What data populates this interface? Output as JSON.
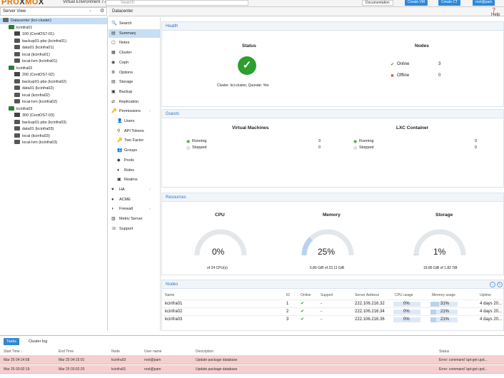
{
  "app": {
    "logo_a": "PRO",
    "logo_x": "X",
    "logo_b": "MO",
    "logo_x2": "X",
    "version": "Virtual Environment 7.4-3",
    "search_placeholder": "Search",
    "buttons": {
      "documentation": "Documentation",
      "create_vm": "Create VM",
      "create_ct": "Create CT",
      "user": "root@pam"
    }
  },
  "server_view": {
    "label": "Server View"
  },
  "tree": [
    {
      "label": "Datacenter (kci-cluster)",
      "icon": "datacenter-icon",
      "level": 0
    },
    {
      "label": "kcinfra01",
      "icon": "node-icon",
      "level": 1
    },
    {
      "label": "100 (CentOS7-01)",
      "icon": "vm-icon",
      "level": 2
    },
    {
      "label": "backup01-pbs (kcinfra01)",
      "icon": "storage-icon",
      "level": 2
    },
    {
      "label": "data01 (kcinfra01)",
      "icon": "storage-icon",
      "level": 2
    },
    {
      "label": "local (kcinfra01)",
      "icon": "storage-icon",
      "level": 2
    },
    {
      "label": "local-lvm (kcinfra01)",
      "icon": "storage-icon",
      "level": 2
    },
    {
      "label": "kcinfra02",
      "icon": "node-icon",
      "level": 1
    },
    {
      "label": "200 (CentOS7-02)",
      "icon": "vm-icon",
      "level": 2
    },
    {
      "label": "backup01-pbs (kcinfra02)",
      "icon": "storage-icon",
      "level": 2
    },
    {
      "label": "data01 (kcinfra02)",
      "icon": "storage-icon",
      "level": 2
    },
    {
      "label": "local (kcinfra02)",
      "icon": "storage-icon",
      "level": 2
    },
    {
      "label": "local-lvm (kcinfra02)",
      "icon": "storage-icon",
      "level": 2
    },
    {
      "label": "kcinfra03",
      "icon": "node-icon",
      "level": 1
    },
    {
      "label": "300 (CentOS7-03)",
      "icon": "vm-icon",
      "level": 2
    },
    {
      "label": "backup01-pbs (kcinfra03)",
      "icon": "storage-icon",
      "level": 2
    },
    {
      "label": "data01 (kcinfra03)",
      "icon": "storage-icon",
      "level": 2
    },
    {
      "label": "local (kcinfra03)",
      "icon": "storage-icon",
      "level": 2
    },
    {
      "label": "local-lvm (kcinfra03)",
      "icon": "storage-icon",
      "level": 2
    }
  ],
  "crumb": "Datacenter",
  "help": "Help",
  "menu": [
    {
      "label": "Search",
      "icon": "search-icon",
      "glyph": "🔍"
    },
    {
      "label": "Summary",
      "icon": "summary-icon",
      "glyph": "▤",
      "selected": true
    },
    {
      "label": "Notes",
      "icon": "notes-icon",
      "glyph": "▢"
    },
    {
      "label": "Cluster",
      "icon": "cluster-icon",
      "glyph": "▦"
    },
    {
      "label": "Ceph",
      "icon": "ceph-icon",
      "glyph": "◉"
    },
    {
      "label": "Options",
      "icon": "options-icon",
      "glyph": "⚙"
    },
    {
      "label": "Storage",
      "icon": "storage-icon",
      "glyph": "▤"
    },
    {
      "label": "Backup",
      "icon": "backup-icon",
      "glyph": "▣"
    },
    {
      "label": "Replication",
      "icon": "replication-icon",
      "glyph": "⇄"
    },
    {
      "label": "Permissions",
      "icon": "permissions-icon",
      "glyph": "🔑",
      "expand": true
    },
    {
      "label": "Users",
      "icon": "user-icon",
      "glyph": "👤",
      "sub": true
    },
    {
      "label": "API Tokens",
      "icon": "api-token-icon",
      "glyph": "⚲",
      "sub": true
    },
    {
      "label": "Two Factor",
      "icon": "two-factor-icon",
      "glyph": "🔑",
      "sub": true
    },
    {
      "label": "Groups",
      "icon": "groups-icon",
      "glyph": "👥",
      "sub": true
    },
    {
      "label": "Pools",
      "icon": "pools-icon",
      "glyph": "◆",
      "sub": true
    },
    {
      "label": "Roles",
      "icon": "roles-icon",
      "glyph": "♦",
      "sub": true
    },
    {
      "label": "Realms",
      "icon": "realms-icon",
      "glyph": "▣",
      "sub": true
    },
    {
      "label": "HA",
      "icon": "ha-icon",
      "glyph": "♥",
      "expand": true
    },
    {
      "label": "ACME",
      "icon": "acme-icon",
      "glyph": "●"
    },
    {
      "label": "Firewall",
      "icon": "firewall-icon",
      "glyph": "◗",
      "expand": true
    },
    {
      "label": "Metric Server",
      "icon": "metric-icon",
      "glyph": "▥"
    },
    {
      "label": "Support",
      "icon": "support-icon",
      "glyph": "☏"
    }
  ],
  "health": {
    "title": "Health",
    "status_heading": "Status",
    "nodes_heading": "Nodes",
    "status_text": "Cluster: kci-cluster, Quorate: Yes",
    "online_label": "Online",
    "online_count": "3",
    "offline_label": "Offline",
    "offline_count": "0"
  },
  "guests": {
    "title": "Guests",
    "vm_heading": "Virtual Machines",
    "lxc_heading": "LXC Container",
    "vm_running_label": "Running",
    "vm_running": "3",
    "vm_stopped_label": "Stopped",
    "vm_stopped": "0",
    "lxc_running_label": "Running",
    "lxc_running": "0",
    "lxc_stopped_label": "Stopped",
    "lxc_stopped": "0"
  },
  "resources": {
    "title": "Resources",
    "cpu": {
      "label": "CPU",
      "percent": 0,
      "value": "0%",
      "sub": "of 24 CPU(s)"
    },
    "memory": {
      "label": "Memory",
      "percent": 25,
      "value": "25%",
      "sub": "5.86 GiB of 23.11 GiB"
    },
    "storage": {
      "label": "Storage",
      "percent": 1,
      "value": "1%",
      "sub": "19.85 GiB of 1.82 TiB"
    }
  },
  "nodes_table": {
    "title": "Nodes",
    "headers": [
      "Name",
      "ID",
      "Online",
      "Support",
      "Server Address",
      "CPU usage",
      "Memory usage",
      "Uptime"
    ],
    "rows": [
      {
        "name": "kcinfra01",
        "id": "1",
        "online": "✔",
        "support": "-",
        "address": "222.106.216.32",
        "cpu": "0%",
        "cpu_frac": 0,
        "mem": "31%",
        "mem_frac": 0.31,
        "uptime": "4 days 20..."
      },
      {
        "name": "kcinfra02",
        "id": "2",
        "online": "✔",
        "support": "-",
        "address": "222.106.216.34",
        "cpu": "0%",
        "cpu_frac": 0,
        "mem": "21%",
        "mem_frac": 0.21,
        "uptime": "4 days 20..."
      },
      {
        "name": "kcinfra03",
        "id": "3",
        "online": "✔",
        "support": "-",
        "address": "222.106.216.36",
        "cpu": "0%",
        "cpu_frac": 0,
        "mem": "21%",
        "mem_frac": 0.21,
        "uptime": "4 days 20..."
      }
    ]
  },
  "tasks": {
    "tab_tasks": "Tasks",
    "tab_log": "Cluster log",
    "headers": [
      "Start Time ↓",
      "End Time",
      "Node",
      "User name",
      "Description",
      "Status"
    ],
    "rows": [
      {
        "start": "Mar 25 04:14:58",
        "end": "Mar 25 04:15:01",
        "node": "kcinfra03",
        "user": "root@pam",
        "desc": "Update package database",
        "status": "Error: command 'apt-get upd..."
      },
      {
        "start": "Mar 25 03:02:19",
        "end": "Mar 25 03:02:20",
        "node": "kcinfra01",
        "user": "root@pam",
        "desc": "Update package database",
        "status": "Error: command 'apt-get upd..."
      }
    ]
  },
  "colors": {
    "accent": "#2f88d6",
    "brand": "#e57000",
    "ok": "#2e9e2e",
    "error": "#d33",
    "gauge_track": "#e3e7ea",
    "gauge_fill": "#b9d2ee"
  }
}
